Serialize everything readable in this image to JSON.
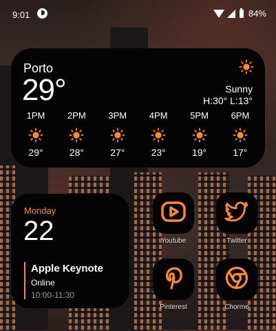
{
  "status_bar": {
    "time": "9:01",
    "battery": "84%"
  },
  "weather": {
    "city": "Porto",
    "temp": "29°",
    "condition": "Sunny",
    "hi_lo": "H:30° L:13°",
    "condition_icon": "sun-icon",
    "hourly": [
      {
        "time": "1PM",
        "temp": "29°",
        "icon": "sun-icon"
      },
      {
        "time": "2PM",
        "temp": "28°",
        "icon": "sun-icon"
      },
      {
        "time": "3PM",
        "temp": "27°",
        "icon": "sun-icon"
      },
      {
        "time": "4PM",
        "temp": "23°",
        "icon": "sun-icon"
      },
      {
        "time": "5PM",
        "temp": "19°",
        "icon": "sun-icon"
      },
      {
        "time": "6PM",
        "temp": "17°",
        "icon": "sun-icon"
      }
    ]
  },
  "calendar": {
    "day": "Monday",
    "date": "22",
    "event": {
      "title": "Apple Keynote",
      "location": "Online",
      "time": "10:00-11:30"
    }
  },
  "apps": [
    {
      "label": "Youtube",
      "icon": "youtube-icon"
    },
    {
      "label": "Twitter",
      "icon": "twitter-icon"
    },
    {
      "label": "Pinterest",
      "icon": "pinterest-icon"
    },
    {
      "label": "Chorme",
      "icon": "chrome-icon"
    }
  ],
  "colors": {
    "accent": "#ff8a2a",
    "widget_bg": "#050404"
  }
}
